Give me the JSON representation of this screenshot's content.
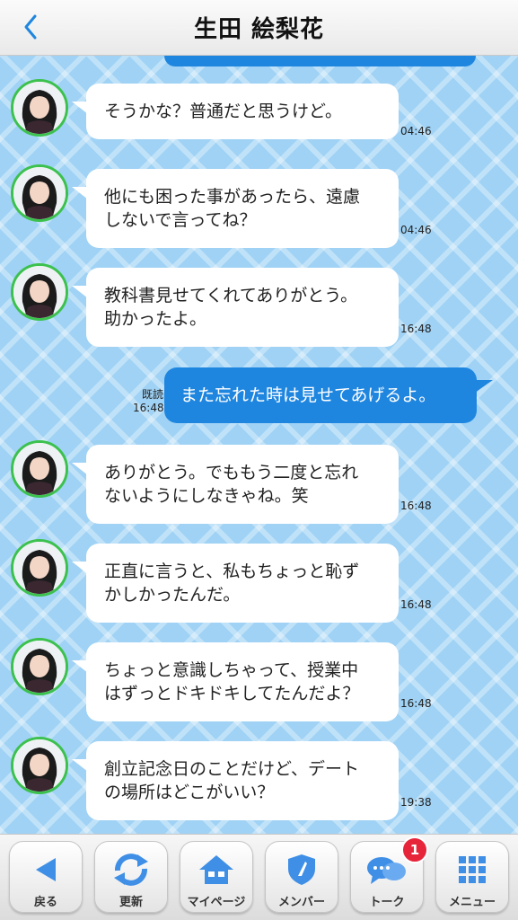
{
  "header": {
    "title": "生田 絵梨花",
    "back_icon": "chevron-left-icon"
  },
  "messages": [
    {
      "type": "in",
      "lines": [
        "そうかな？普通だと思うけど。"
      ],
      "time": "04:46"
    },
    {
      "type": "in",
      "lines": [
        "他にも困った事があったら、遠慮",
        "しないで言ってね？"
      ],
      "time": "04:46"
    },
    {
      "type": "in",
      "lines": [
        "教科書見せてくれてありがとう。",
        "助かったよ。"
      ],
      "time": "16:48"
    },
    {
      "type": "out",
      "lines": [
        "また忘れた時は見せてあげるよ。"
      ],
      "read": "既読",
      "time": "16:48"
    },
    {
      "type": "in",
      "lines": [
        "ありがとう。でももう二度と忘れ",
        "ないようにしなきゃね。笑"
      ],
      "time": "16:48"
    },
    {
      "type": "in",
      "lines": [
        "正直に言うと、私もちょっと恥ず",
        "かしかったんだ。"
      ],
      "time": "16:48"
    },
    {
      "type": "in",
      "lines": [
        "ちょっと意識しちゃって、授業中",
        "はずっとドキドキしてたんだよ？"
      ],
      "time": "16:48"
    },
    {
      "type": "in",
      "lines": [
        "創立記念日のことだけど、デート",
        "の場所はどこがいい？"
      ],
      "time": "19:38"
    }
  ],
  "nav": {
    "back_label": "戻る",
    "refresh_label": "更新",
    "mypage_label": "マイページ",
    "members_label": "メンバー",
    "talk_label": "トーク",
    "talk_badge": "1",
    "menu_label": "メニュー"
  },
  "colors": {
    "accent_blue": "#1f86e0",
    "chat_bg": "#9fd2f5",
    "avatar_ring": "#3cc14e",
    "badge_red": "#e7253a"
  }
}
